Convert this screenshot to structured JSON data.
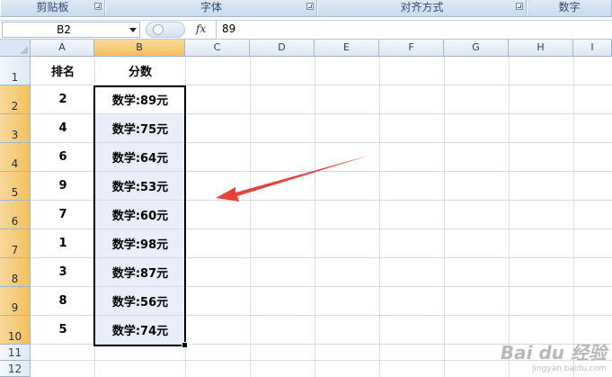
{
  "ribbon": {
    "groups": [
      {
        "label": "剪贴板"
      },
      {
        "label": "字体"
      },
      {
        "label": "对齐方式"
      },
      {
        "label": "数字"
      }
    ]
  },
  "formula_bar": {
    "name_box": "B2",
    "fx_label": "fx",
    "value": "89"
  },
  "sheet": {
    "columns": [
      "A",
      "B",
      "C",
      "D",
      "E",
      "F",
      "G",
      "H",
      "I"
    ],
    "selected_column": "B",
    "rows": [
      "1",
      "2",
      "3",
      "4",
      "5",
      "6",
      "7",
      "8",
      "9",
      "10",
      "11",
      "12"
    ],
    "header": {
      "a": "排名",
      "b": "分数"
    },
    "data": [
      {
        "a": "2",
        "b": "数学:89元"
      },
      {
        "a": "4",
        "b": "数学:75元"
      },
      {
        "a": "6",
        "b": "数学:64元"
      },
      {
        "a": "9",
        "b": "数学:53元"
      },
      {
        "a": "7",
        "b": "数学:60元"
      },
      {
        "a": "1",
        "b": "数学:98元"
      },
      {
        "a": "3",
        "b": "数学:87元"
      },
      {
        "a": "8",
        "b": "数学:56元"
      },
      {
        "a": "5",
        "b": "数学:74元"
      }
    ]
  },
  "annotation": {
    "arrow_color": "#e8413a"
  },
  "watermark": {
    "brand": "Bai du 经验",
    "url": "jingyan.baidu.com"
  }
}
